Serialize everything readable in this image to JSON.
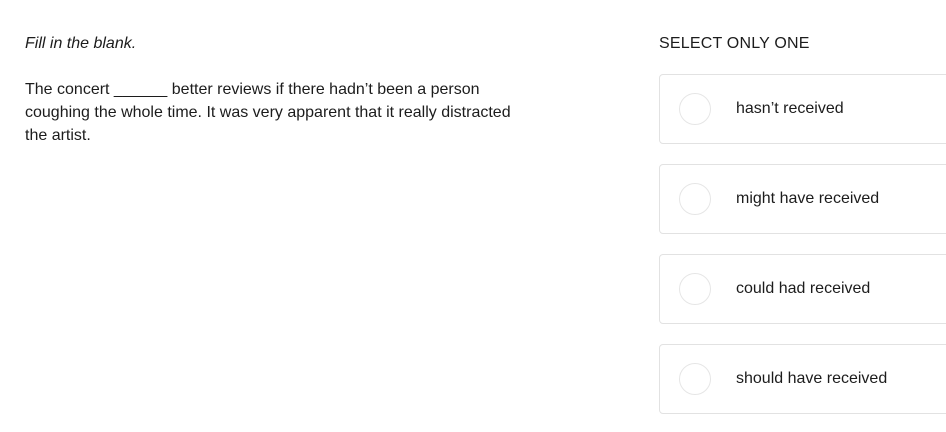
{
  "prompt": {
    "instruction": "Fill in the blank.",
    "question": "The concert ______ better reviews if there hadn’t been a person coughing the whole time. It was very apparent that it really distracted the artist."
  },
  "answers": {
    "select_label": "SELECT ONLY ONE",
    "options": [
      {
        "label": "hasn’t received"
      },
      {
        "label": "might have received"
      },
      {
        "label": "could had received"
      },
      {
        "label": "should have received"
      }
    ]
  }
}
